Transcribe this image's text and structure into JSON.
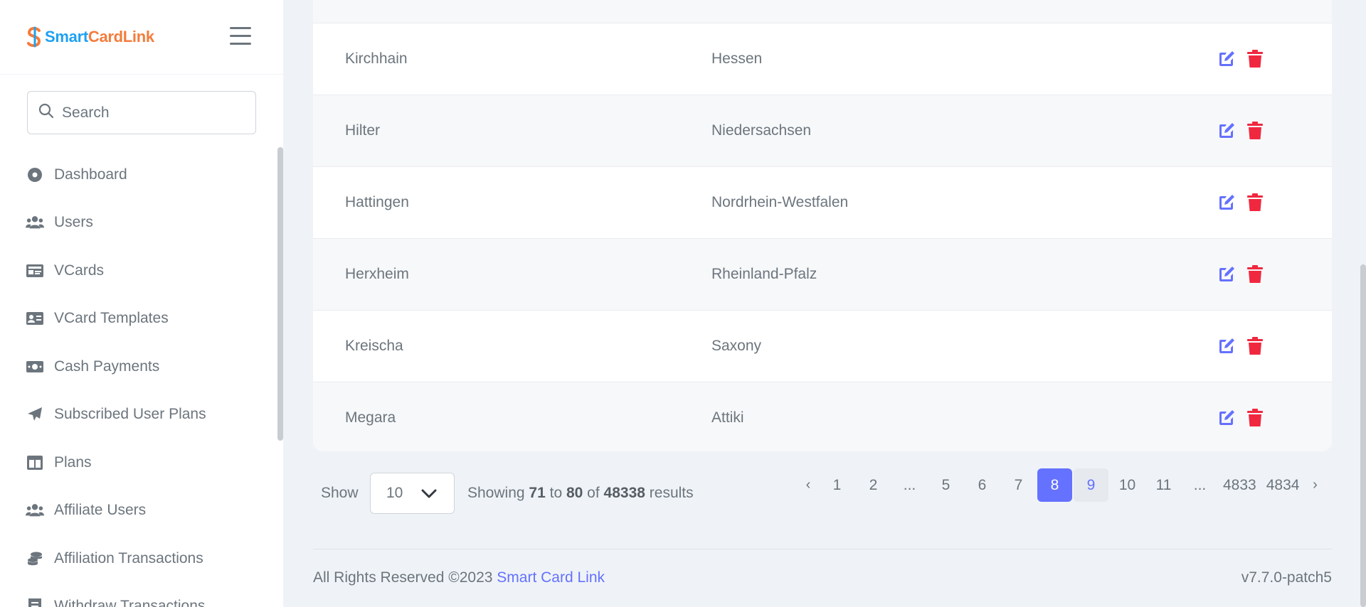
{
  "brand": {
    "name_part1": "Smart",
    "name_part2": "CardLink",
    "color1": "#1ea1f1",
    "color2": "#f47c3c"
  },
  "search": {
    "placeholder": "Search"
  },
  "sidebar": {
    "items": [
      {
        "label": "Dashboard",
        "icon": "dashboard-icon"
      },
      {
        "label": "Users",
        "icon": "users-icon"
      },
      {
        "label": "VCards",
        "icon": "vcard-icon"
      },
      {
        "label": "VCard Templates",
        "icon": "id-card-icon"
      },
      {
        "label": "Cash Payments",
        "icon": "money-bill-icon"
      },
      {
        "label": "Subscribed User Plans",
        "icon": "paper-plane-icon"
      },
      {
        "label": "Plans",
        "icon": "table-columns-icon"
      },
      {
        "label": "Affiliate Users",
        "icon": "users-icon"
      },
      {
        "label": "Affiliation Transactions",
        "icon": "coins-icon"
      },
      {
        "label": "Withdraw Transactions",
        "icon": "receipt-icon"
      }
    ]
  },
  "table": {
    "rows": [
      {
        "city": "Kirchhain",
        "state": "Hessen"
      },
      {
        "city": "Hilter",
        "state": "Niedersachsen"
      },
      {
        "city": "Hattingen",
        "state": "Nordrhein-Westfalen"
      },
      {
        "city": "Herxheim",
        "state": "Rheinland-Pfalz"
      },
      {
        "city": "Kreischa",
        "state": "Saxony"
      },
      {
        "city": "Megara",
        "state": "Attiki"
      }
    ],
    "edit_color": "#6571ff",
    "delete_color": "#f0283f"
  },
  "pagination": {
    "show_label": "Show",
    "per_page": "10",
    "showing_prefix": "Showing",
    "from": "71",
    "to_word": "to",
    "to": "80",
    "of_word": "of",
    "total": "48338",
    "results_word": "results",
    "prev": "‹",
    "next": "›",
    "pages": [
      "1",
      "2",
      "...",
      "5",
      "6",
      "7",
      "8",
      "9",
      "10",
      "11",
      "...",
      "4833",
      "4834"
    ],
    "active_page": "8",
    "hover_page": "9",
    "accent": "#6571ff"
  },
  "footer": {
    "rights": "All Rights Reserved ©2023",
    "link": "Smart Card Link",
    "version": "v7.7.0-patch5"
  }
}
